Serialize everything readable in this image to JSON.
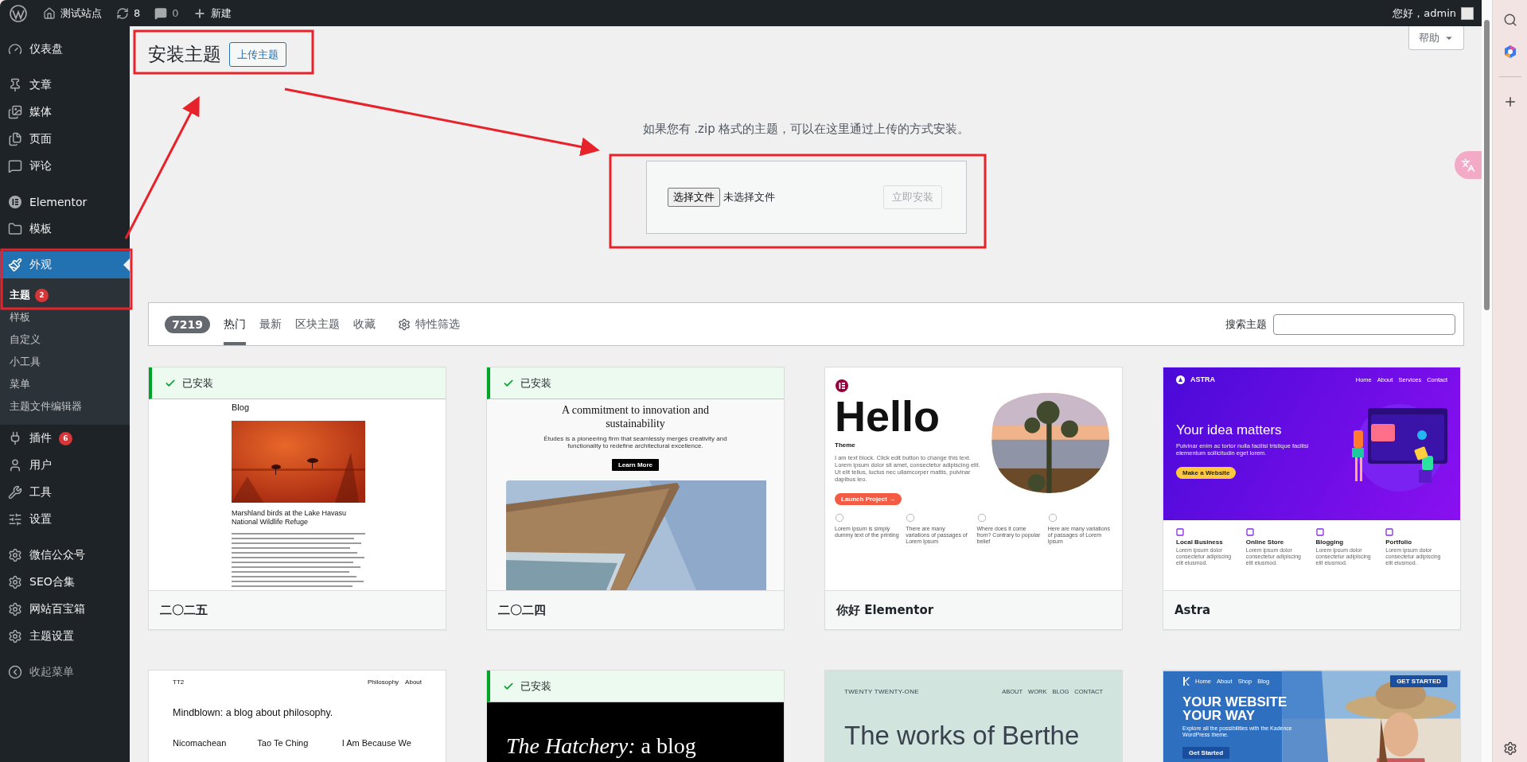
{
  "admin_bar": {
    "site_name": "测试站点",
    "updates": "8",
    "comments": "0",
    "new_label": "新建",
    "greeting": "您好，admin"
  },
  "sidebar": {
    "groups": [
      [
        {
          "label": "仪表盘",
          "selected": false
        }
      ],
      [
        {
          "label": "文章",
          "selected": false
        },
        {
          "label": "媒体",
          "selected": false
        },
        {
          "label": "页面",
          "selected": false
        },
        {
          "label": "评论",
          "selected": false
        }
      ],
      [
        {
          "label": "Elementor",
          "selected": false
        },
        {
          "label": "模板",
          "selected": false
        }
      ],
      [
        {
          "label": "外观",
          "selected": true,
          "children": [
            {
              "label": "主题",
              "selected": true,
              "badge": "2"
            },
            {
              "label": "样板",
              "selected": false
            },
            {
              "label": "自定义",
              "selected": false
            },
            {
              "label": "小工具",
              "selected": false
            },
            {
              "label": "菜单",
              "selected": false
            },
            {
              "label": "主题文件编辑器",
              "selected": false
            }
          ]
        },
        {
          "label": "插件",
          "selected": false,
          "badge": "6"
        },
        {
          "label": "用户",
          "selected": false
        },
        {
          "label": "工具",
          "selected": false
        },
        {
          "label": "设置",
          "selected": false
        }
      ],
      [
        {
          "label": "微信公众号",
          "selected": false
        },
        {
          "label": "SEO合集",
          "selected": false
        },
        {
          "label": "网站百宝箱",
          "selected": false
        },
        {
          "label": "主题设置",
          "selected": false
        }
      ],
      [
        {
          "label": "收起菜单",
          "selected": false,
          "kind": "collapse"
        }
      ]
    ]
  },
  "header": {
    "title": "安装主题",
    "upload_button": "上传主题",
    "help": "帮助"
  },
  "upload": {
    "hint": "如果您有 .zip 格式的主题，可以在这里通过上传的方式安装。",
    "choose_button": "选择文件",
    "file_status": "未选择文件",
    "install_button": "立即安装",
    "install_disabled": true
  },
  "filter_bar": {
    "count": "7219",
    "tabs": [
      {
        "label": "热门",
        "selected": true
      },
      {
        "label": "最新",
        "selected": false
      },
      {
        "label": "区块主题",
        "selected": false
      },
      {
        "label": "收藏",
        "selected": false
      }
    ],
    "feature_filter": "特性筛选",
    "search_label": "搜索主题"
  },
  "themes": [
    {
      "name": "二〇二五",
      "installed": true,
      "installed_label": "已安装",
      "preview": {
        "kind": "blog",
        "heading": "Blog",
        "title": "Marshland birds at the Lake Havasu National Wildlife Refuge"
      }
    },
    {
      "name": "二〇二四",
      "installed": true,
      "installed_label": "已安装",
      "preview": {
        "kind": "studio",
        "heading": "A commitment to innovation and sustainability",
        "text": "Études is a pioneering firm that seamlessly merges creativity and functionality to redefine architectural excellence.",
        "button": "Learn More"
      }
    },
    {
      "name": "你好 Elementor",
      "installed": false,
      "preview": {
        "kind": "hello",
        "heading": "Hello",
        "subheading": "Theme",
        "text": "I am text block. Click edit button to change this text. Lorem ipsum dolor sit amet, consectetur adipiscing elit. Ut elit tellus, luctus nec ullamcorper mattis, pulvinar dapibus leo.",
        "button": "Launch Project →",
        "features": [
          "Lorem ipsum is simply dummy text of the printing",
          "There are many variations of passages of Lorem Ipsum",
          "Where does it come from? Contrary to popular belief",
          "Here are many variations of passages of Lorem Ipsum"
        ]
      }
    },
    {
      "name": "Astra",
      "installed": false,
      "preview": {
        "kind": "astra",
        "logo": "ASTRA",
        "nav": [
          "Home",
          "About",
          "Services",
          "Contact"
        ],
        "heading": "Your idea matters",
        "text": "Pulvinar enim ac tortor nulla facilisi tristique facilisi elementum sollicitudin eget lorem.",
        "button": "Make a Website",
        "features": [
          {
            "title": "Local Business",
            "text": "Lorem ipsum dolor consectetur adipiscing elit eiusmod."
          },
          {
            "title": "Online Store",
            "text": "Lorem ipsum dolor consectetur adipiscing elit eiusmod."
          },
          {
            "title": "Blogging",
            "text": "Lorem ipsum dolor consectetur adipiscing elit eiusmod."
          },
          {
            "title": "Portfolio",
            "text": "Lorem ipsum dolor consectetur adipiscing elit eiusmod."
          }
        ]
      }
    },
    {
      "installed": false,
      "preview": {
        "kind": "philosophy",
        "logo": "TT2",
        "nav": [
          "Philosophy",
          "About"
        ],
        "heading": "Mindblown: a blog about philosophy.",
        "posts": [
          "Nicomachean",
          "Tao Te Ching",
          "I Am Because We"
        ]
      }
    },
    {
      "installed": true,
      "installed_label": "已安装",
      "preview": {
        "kind": "hatchery",
        "heading": "*The Hatchery:* a blog"
      }
    },
    {
      "installed": false,
      "preview": {
        "kind": "portfolio",
        "logo": "TWENTY TWENTY-ONE",
        "nav": [
          "ABOUT",
          "WORK",
          "BLOG",
          "CONTACT"
        ],
        "heading": "The works of Berthe"
      }
    },
    {
      "installed": false,
      "preview": {
        "kind": "kadence",
        "nav": [
          "Home",
          "About",
          "Shop",
          "Blog"
        ],
        "cta": "GET STARTED",
        "heading": "YOUR WEBSITE YOUR WAY",
        "text": "Explore all the possibilities with the Kadence WordPress theme.",
        "button": "Get Started"
      }
    }
  ]
}
